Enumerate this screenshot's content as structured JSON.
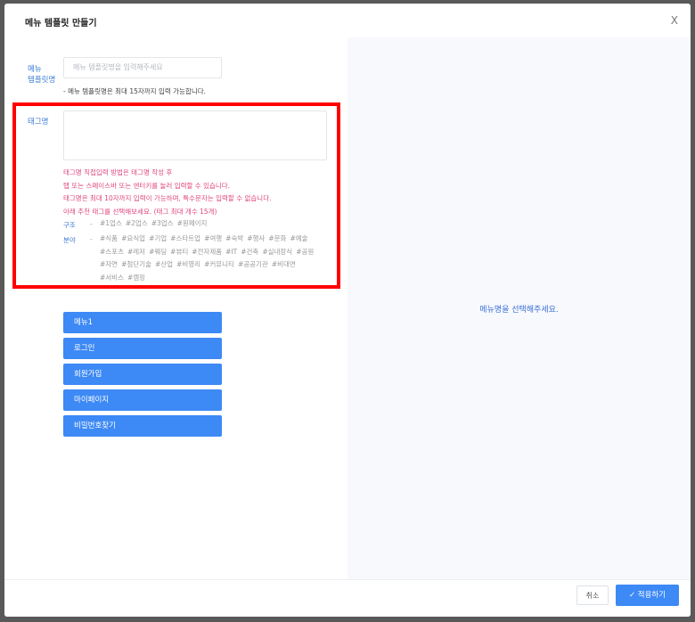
{
  "modal": {
    "title": "메뉴 템플릿 만들기",
    "close_label": "X"
  },
  "template_name": {
    "label_line1": "메뉴",
    "label_line2": "템플릿명",
    "placeholder": "메뉴 템플릿명을 입력해주세요",
    "hint": "- 메뉴 템플릿명은 최대 15자까지 입력 가능합니다."
  },
  "tag": {
    "label": "태그명",
    "value": "",
    "instructions": [
      "태그명 직접입력 방법은 태그명 작성 후",
      "탭 또는 스페이스바 또는 엔터키를 눌러 입력할 수 있습니다.",
      "태그명은 최대 10자까지 입력이 가능하며, 특수문자는 입력할 수 없습니다.",
      "아래 추천 태그를 선택해보세요. (태그 최대 개수 15개)"
    ],
    "structure_label": "구조",
    "structure_dash": "-",
    "structure_tags": [
      "#1업스",
      "#2업스",
      "#3업스",
      "#원페이지"
    ],
    "field_label": "분야",
    "field_dash": "-",
    "field_tags": [
      "#식품",
      "#요식업",
      "#기업",
      "#스타트업",
      "#여행",
      "#숙박",
      "#행사",
      "#문화",
      "#예술",
      "#스포츠",
      "#레저",
      "#웨딩",
      "#뷰티",
      "#전자제품",
      "#IT",
      "#건축",
      "#실내장식",
      "#공원",
      "#자연",
      "#첨단기술",
      "#산업",
      "#비영리",
      "#커뮤니티",
      "#공공기관",
      "#비대면",
      "#서비스",
      "#캠핑"
    ]
  },
  "menus": [
    "메뉴1",
    "로그인",
    "회원가입",
    "마이페이지",
    "비밀번호찾기"
  ],
  "right_panel": {
    "message": "메뉴명을 선택해주세요."
  },
  "footer": {
    "cancel": "취소",
    "apply_icon": "✓",
    "apply": "적용하기"
  }
}
